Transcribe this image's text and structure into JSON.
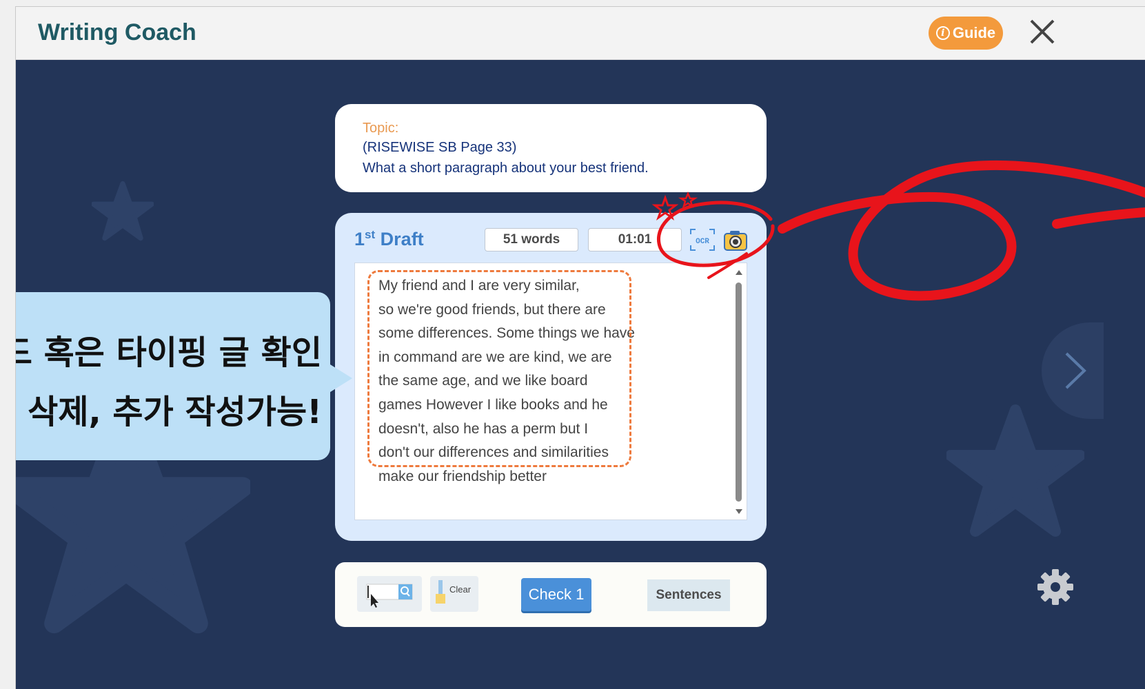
{
  "app": {
    "title": "Writing Coach"
  },
  "header": {
    "guide_label": "Guide",
    "guide_icon": "info-icon",
    "close_icon": "close-icon"
  },
  "topic": {
    "label": "Topic:",
    "line1": "(RISEWISE SB Page 33)",
    "line2": "What a short paragraph about your best friend."
  },
  "draft": {
    "title_number": "1",
    "title_suffix": "st",
    "title_word": "Draft",
    "word_count": "51 words",
    "timer": "01:01",
    "ocr_label": "OCR",
    "essay_lines": [
      "My friend and I are very similar,",
      "so we're good friends, but there are",
      "some differences. Some things we have",
      "in command are we are kind, we are",
      "the same age, and we like board",
      "games However I like books and he",
      "doesn't, also he has a perm but I",
      "don't our differences and similarities",
      "make our friendship better"
    ]
  },
  "toolbar": {
    "clear_label": "Clear",
    "check_label": "Check 1",
    "sentences_label": "Sentences"
  },
  "callout": {
    "line1": "드 혹은 타이핑 글 확인",
    "line2": ", 삭제, 추가 작성가능!"
  },
  "colors": {
    "background": "#233558",
    "accent_orange": "#f39a3c",
    "check_blue": "#4a90d9",
    "annotation_red": "#e8141b"
  }
}
